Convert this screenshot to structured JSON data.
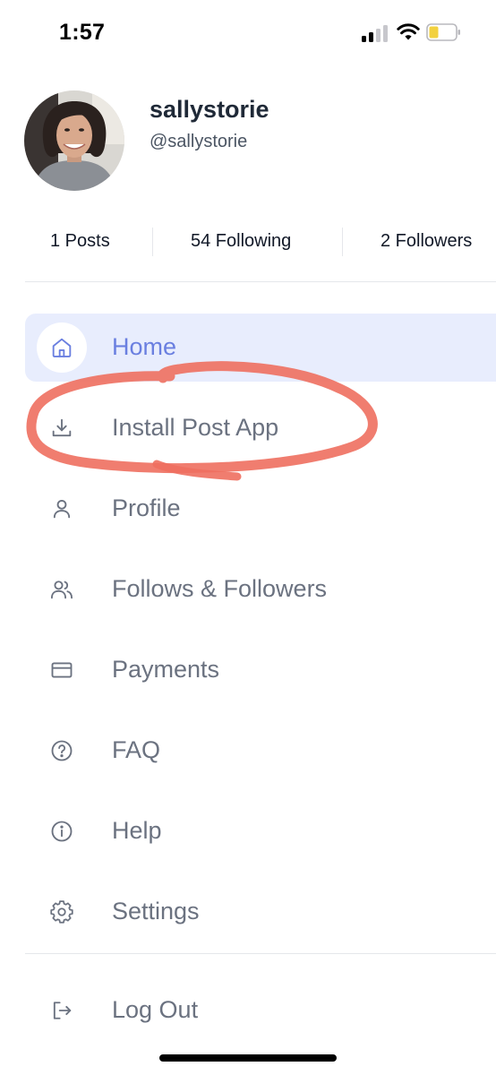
{
  "status_bar": {
    "time": "1:57"
  },
  "profile": {
    "name": "sallystorie",
    "handle": "@sallystorie"
  },
  "stats": {
    "posts": "1 Posts",
    "following": "54 Following",
    "followers": "2 Followers"
  },
  "menu": {
    "items": [
      {
        "label": "Home",
        "icon": "home-icon",
        "active": true
      },
      {
        "label": "Install Post App",
        "icon": "download-icon",
        "active": false
      },
      {
        "label": "Profile",
        "icon": "user-icon",
        "active": false
      },
      {
        "label": "Follows & Followers",
        "icon": "users-icon",
        "active": false
      },
      {
        "label": "Payments",
        "icon": "credit-card-icon",
        "active": false
      },
      {
        "label": "FAQ",
        "icon": "question-circle-icon",
        "active": false
      },
      {
        "label": "Help",
        "icon": "info-circle-icon",
        "active": false
      },
      {
        "label": "Settings",
        "icon": "gear-icon",
        "active": false
      }
    ],
    "logout": {
      "label": "Log Out",
      "icon": "logout-icon"
    }
  },
  "colors": {
    "accent": "#6a7fe0",
    "active_bg": "#e8edfd",
    "muted_text": "#6b7280",
    "annotation": "#ee6f5f"
  }
}
